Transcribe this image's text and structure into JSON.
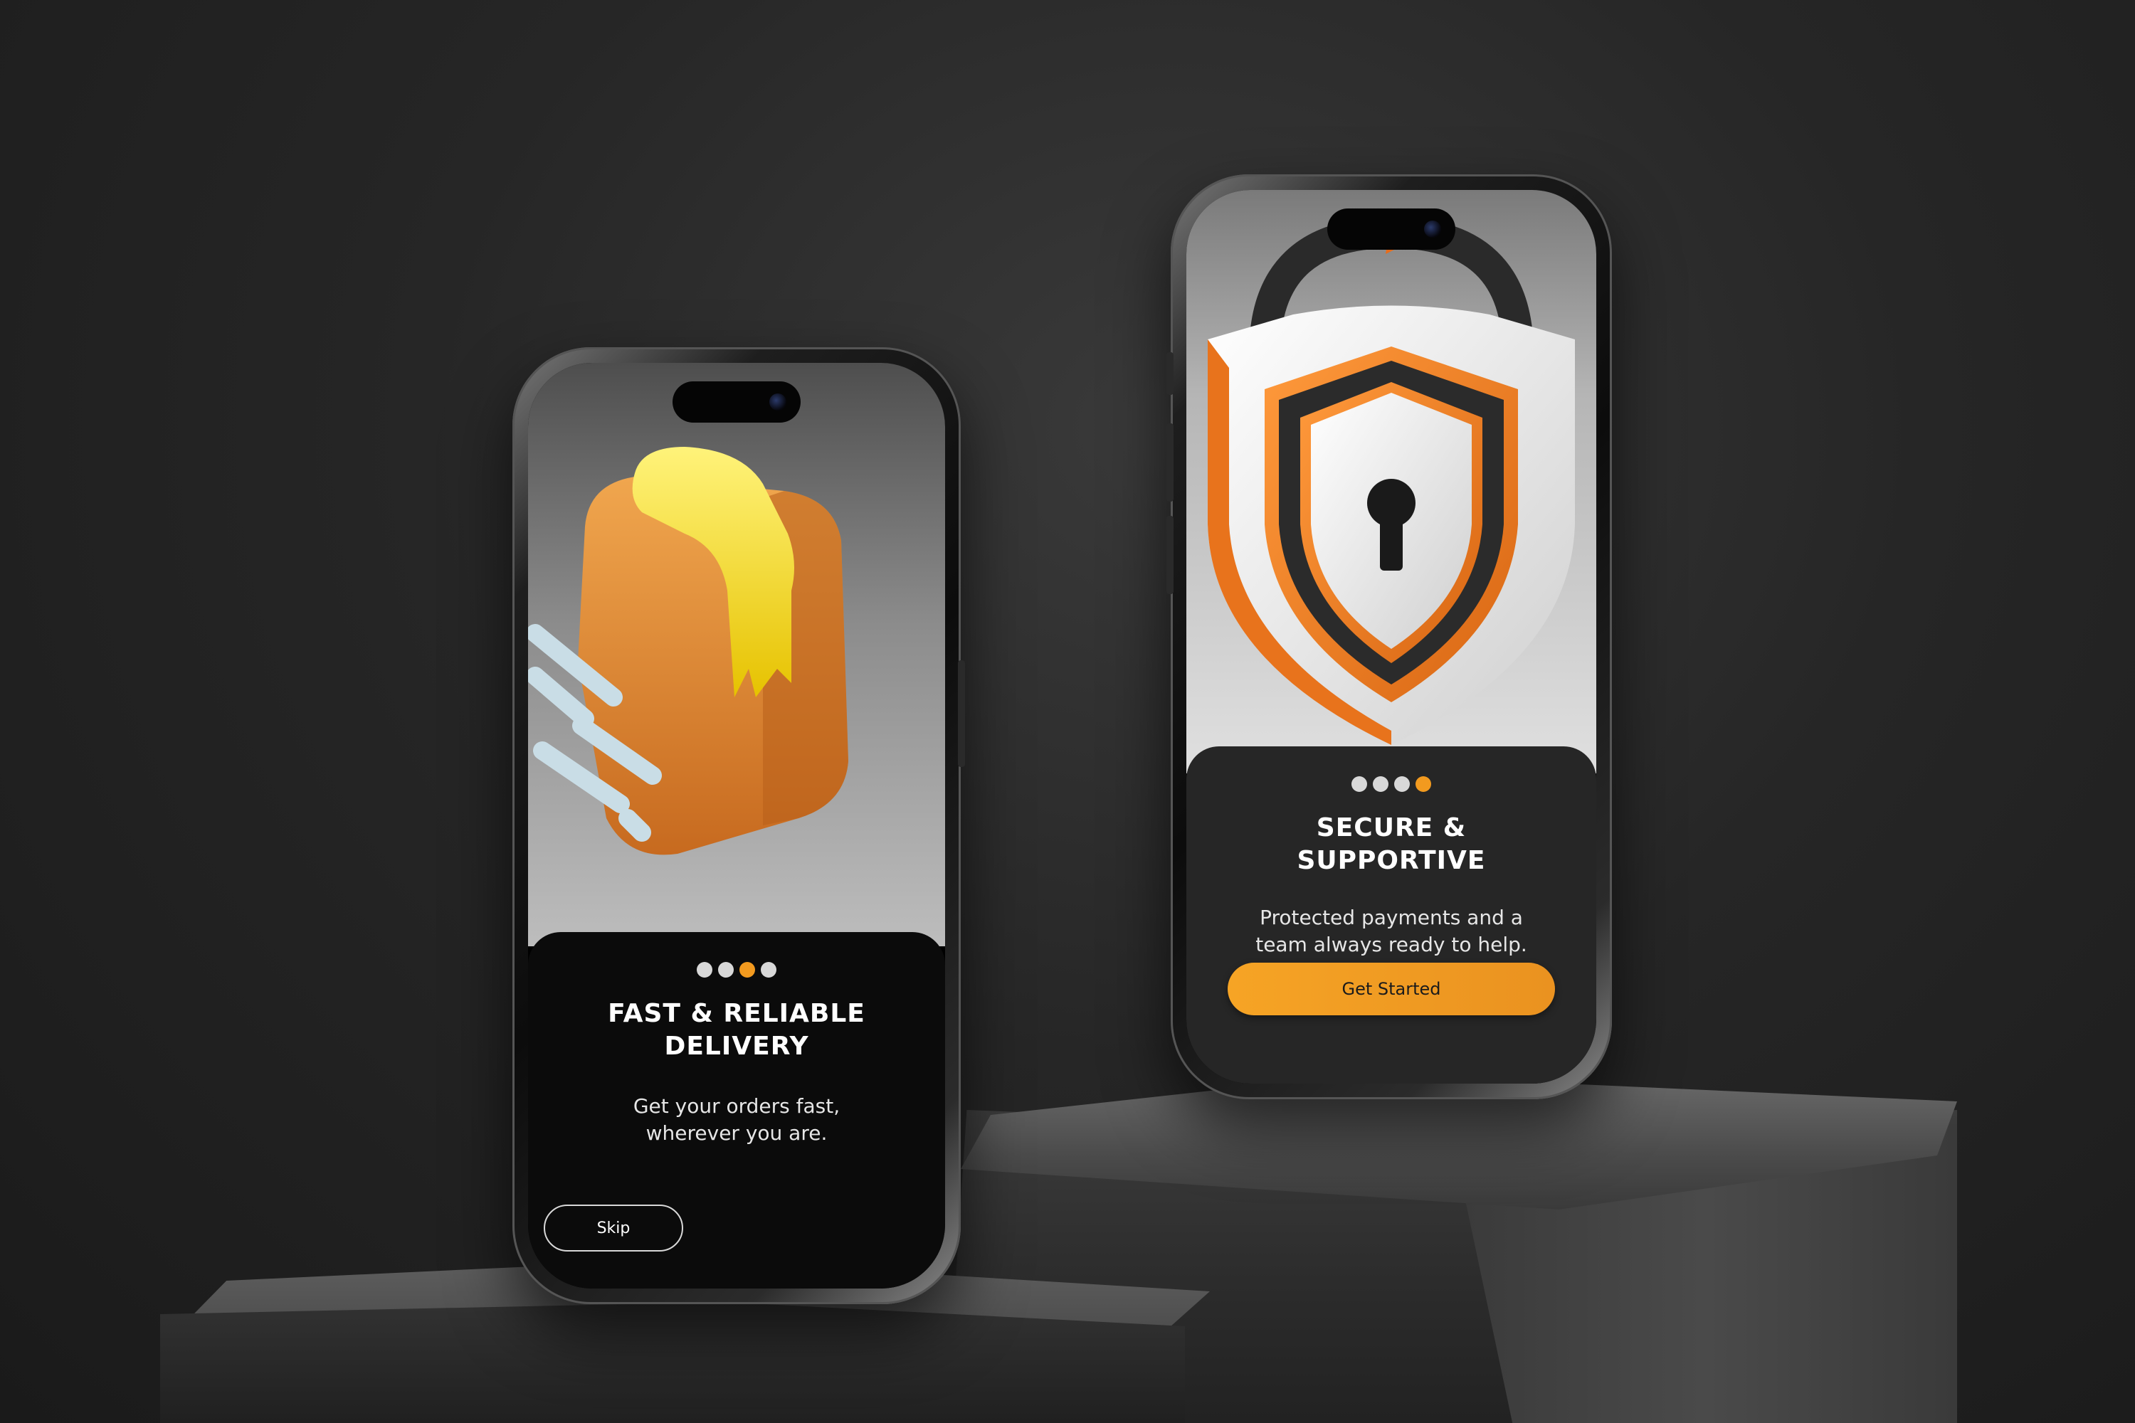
{
  "screens": [
    {
      "id": "onboarding-delivery",
      "illustration": "package-box-icon",
      "pagination": {
        "total": 4,
        "active_index": 2
      },
      "title": "Fast & Reliable\nDelivery",
      "subtitle": "Get your orders fast,\nwherever you are.",
      "skip_label": "Skip"
    },
    {
      "id": "onboarding-secure",
      "illustration": "shield-lock-icon",
      "pagination": {
        "total": 4,
        "active_index": 3
      },
      "title": "Secure &\nSupportive",
      "subtitle": "Protected payments and a\nteam always ready to help.",
      "cta_label": "Get Started"
    }
  ],
  "colors": {
    "accent": "#f29a1f",
    "card_dark": "#0b0b0b",
    "card_grey": "#262626",
    "dot_inactive": "#d8d8d8"
  }
}
